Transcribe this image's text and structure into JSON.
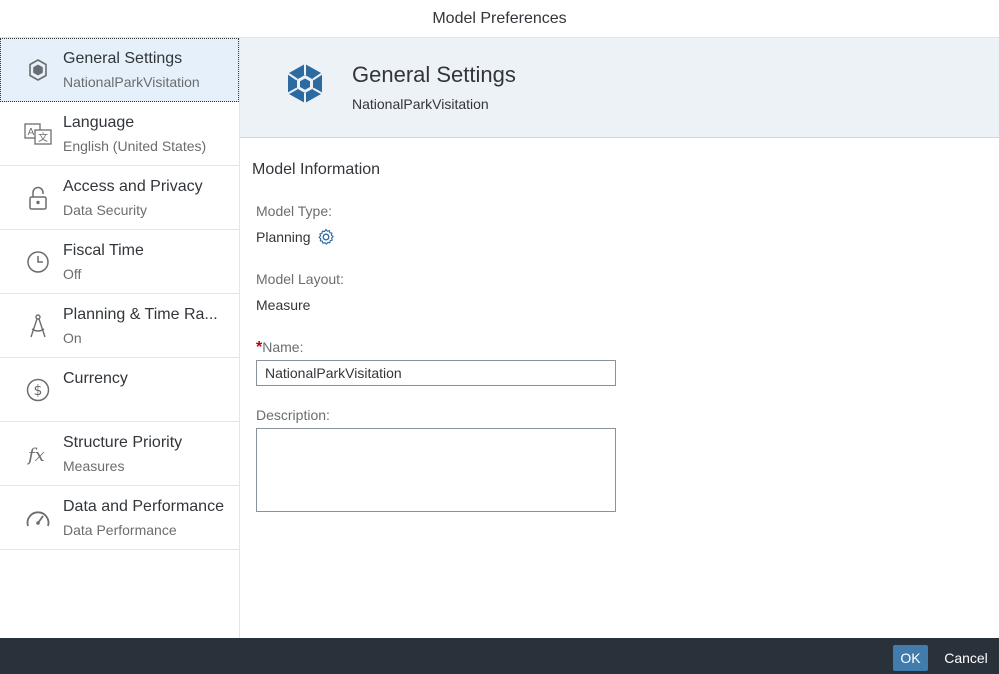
{
  "window": {
    "title": "Model Preferences"
  },
  "sidebar": {
    "items": [
      {
        "title": "General Settings",
        "subtitle": "NationalParkVisitation",
        "icon": "cube-icon",
        "selected": true
      },
      {
        "title": "Language",
        "subtitle": "English (United States)",
        "icon": "translate-icon"
      },
      {
        "title": "Access and Privacy",
        "subtitle": "Data Security",
        "icon": "unlocked-icon"
      },
      {
        "title": "Fiscal Time",
        "subtitle": "Off",
        "icon": "clock-icon"
      },
      {
        "title": "Planning & Time Ra...",
        "subtitle": "On",
        "icon": "compass-icon"
      },
      {
        "title": "Currency",
        "subtitle": "",
        "icon": "dollar-icon"
      },
      {
        "title": "Structure Priority",
        "subtitle": "Measures",
        "icon": "function-icon"
      },
      {
        "title": "Data and Performance",
        "subtitle": "Data Performance",
        "icon": "speedometer-icon"
      }
    ]
  },
  "header": {
    "title": "General Settings",
    "subtitle": "NationalParkVisitation",
    "icon": "cube-icon"
  },
  "form": {
    "section_title": "Model Information",
    "model_type_label": "Model Type:",
    "model_type_value": "Planning",
    "model_layout_label": "Model Layout:",
    "model_layout_value": "Measure",
    "name_required": "*",
    "name_label": "Name:",
    "name_value": "NationalParkVisitation",
    "description_label": "Description:",
    "description_value": ""
  },
  "footer": {
    "ok_label": "OK",
    "cancel_label": "Cancel"
  },
  "colors": {
    "accent": "#427cac",
    "footer_bg": "#29313a",
    "header_bg": "#edf2f7",
    "selected_bg": "#e5f0fa",
    "required": "#bb0000"
  }
}
